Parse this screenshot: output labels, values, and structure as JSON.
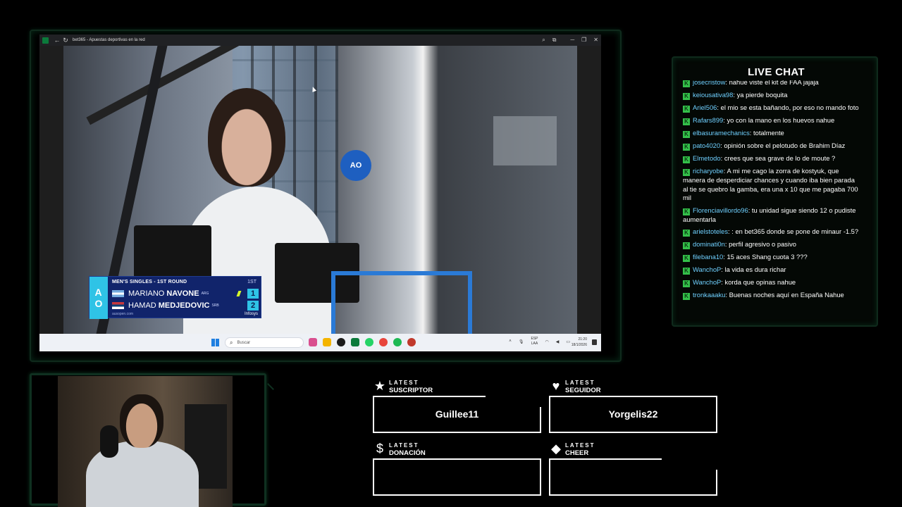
{
  "browser": {
    "title": "bet365 - Apuestas deportivas en la red",
    "controls": {
      "zoom": "⌕",
      "extensions": "⧉",
      "minimize": "─",
      "restore": "❐",
      "close": "✕"
    }
  },
  "scoreboard": {
    "round": "MEN'S SINGLES - 1ST ROUND",
    "set_label": "1ST",
    "players": [
      {
        "first": "MARIANO",
        "last": "NAVONE",
        "country": "ARG",
        "score": "1",
        "serving": true
      },
      {
        "first": "HAMAD",
        "last": "MEDJEDOVIC",
        "country": "SRB",
        "score": "2",
        "serving": false
      }
    ],
    "url": "ausopen.com",
    "sponsor": "Infosys"
  },
  "taskbar": {
    "search_placeholder": "Buscar",
    "lang_top": "ESP",
    "lang_bottom": "LAA",
    "time": "21:20",
    "date": "18/1/2026",
    "app_colors": [
      "#d94f8f",
      "#f4b400",
      "#1a1a1a",
      "#1db954",
      "#0b7a3b",
      "#25d366",
      "#e8453c",
      "#1d9bf0",
      "#c0392b"
    ]
  },
  "chat": {
    "title": "LIVE CHAT",
    "messages": [
      {
        "user": "josecristow",
        "text": "nahue viste el kit de FAA jajaja"
      },
      {
        "user": "keiousativa98",
        "text": "ya pierde boquita"
      },
      {
        "user": "Ariel506",
        "text": "el mio se esta bañando, por eso no mando foto"
      },
      {
        "user": "Rafars899",
        "text": "yo con la mano en los huevos nahue"
      },
      {
        "user": "elbasuramechanics",
        "text": "totalmente"
      },
      {
        "user": "pato4020",
        "text": "opinión sobre el pelotudo de Brahim Díaz"
      },
      {
        "user": "Elmetodo",
        "text": "crees que sea grave de lo de moute ?"
      },
      {
        "user": "richaryobe",
        "text": "A mi me cago la zorra de kostyuk, que manera de desperdiciar chances y cuando iba bien parada al tie se quebro la gamba, era una x 10 que me pagaba 700 mil"
      },
      {
        "user": "Florenciavillordo96",
        "text": "tu unidad sigue siendo 12 o pudiste aumentarla"
      },
      {
        "user": "arielstoteles",
        "text": ": en bet365 donde se pone de minaur -1.5?"
      },
      {
        "user": "dominati0n",
        "text": "perfil agresivo o pasivo"
      },
      {
        "user": "filebana10",
        "text": "15 aces Shang cuota 3 ???"
      },
      {
        "user": "WanchoP",
        "text": "la vida es dura richar"
      },
      {
        "user": "WanchoP",
        "text": "korda que opinas nahue"
      },
      {
        "user": "tronkaaaku",
        "text": "Buenas noches aquí en España Nahue"
      }
    ]
  },
  "widgets": {
    "subscriber": {
      "small": "LATEST",
      "big": "SUSCRIPTOR",
      "value": "Guillee11",
      "icon": "star-icon"
    },
    "follower": {
      "small": "LATEST",
      "big": "SEGUIDOR",
      "value": "Yorgelis22",
      "icon": "heart-icon"
    },
    "donation": {
      "small": "LATEST",
      "big": "DONACIÓN",
      "value": "",
      "icon": "dollar-icon"
    },
    "cheer": {
      "small": "LATEST",
      "big": "CHEER",
      "value": "",
      "icon": "diamond-icon"
    }
  }
}
